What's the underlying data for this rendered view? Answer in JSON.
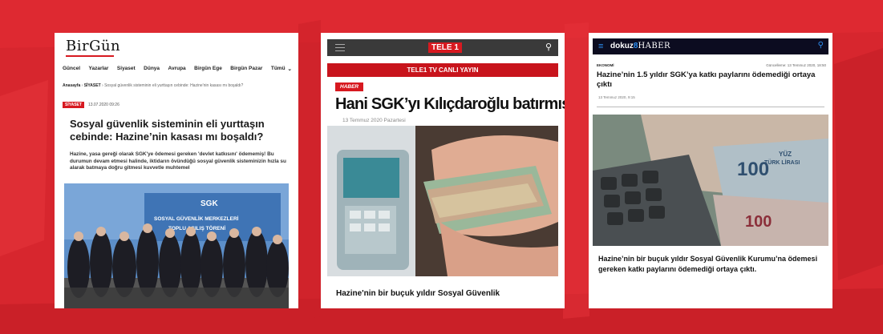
{
  "birgun": {
    "logo_part1": "BirGün",
    "nav": [
      "Güncel",
      "Yazarlar",
      "Siyaset",
      "Dünya",
      "Avrupa",
      "Birgün Ege",
      "Birgün Pazar",
      "Tümü"
    ],
    "breadcrumb_home": "Anasayfa",
    "breadcrumb_section": "SİYASET",
    "breadcrumb_page": "Sosyal güvenlik sisteminin eli yurttaşın cebinde: Hazine'nin kasası mı boşaldı?",
    "tag": "SİYASET",
    "date": "13.07.2020 09:26",
    "title": "Sosyal güvenlik sisteminin eli yurttaşın cebinde: Hazine’nin kasası mı boşaldı?",
    "lead": "Hazine, yasa gereği olarak SGK'ye ödemesi gereken 'devlet katkısını' ödememiş! Bu durumun devam etmesi halinde, iktidarın övündüğü sosyal güvenlik sisteminizin hızla su alarak batmaya doğru gitmesi kuvvetle muhtemel",
    "photo_banner_brand": "SGK",
    "photo_banner_line1": "SOSYAL GÜVENLİK MERKEZLERİ",
    "photo_banner_line2": "TOPLU AÇILIŞ TÖRENİ"
  },
  "tele1": {
    "logo": "TELE 1",
    "live": "TELE1 TV CANLI YAYIN",
    "badge": "HABER",
    "title": "Hani SGK’yı Kılıçdaroğlu batırmıştı?",
    "date": "13 Temmuz 2020 Pazartesi",
    "caption": "Hazine'nin bir buçuk yıldır Sosyal Güvenlik"
  },
  "dokuz8": {
    "logo_a": "dokuz",
    "logo_b": "8",
    "logo_c": "HABER",
    "category": "EKONOMİ",
    "updated": "Güncelleme: 13 Temmuz 2020, 18:50",
    "title": "Hazine’nin 1.5 yıldır SGK’ya katkı paylarını ödemediği ortaya çıktı",
    "date": "13 Temmuz 2020, 9:15",
    "caption": "Hazine’nin bir buçuk yıldır Sosyal Güvenlik Kurumu’na ödemesi gereken katkı paylarını ödemediği ortaya çıktı.",
    "banknote_100": "100",
    "banknote_yuz": "YÜZ",
    "banknote_tl": "TÜRK LİRASI"
  },
  "colors": {
    "background_red": "#d7262e",
    "brand_red": "#d71920",
    "dokuz8_blue": "#2c8df0"
  }
}
